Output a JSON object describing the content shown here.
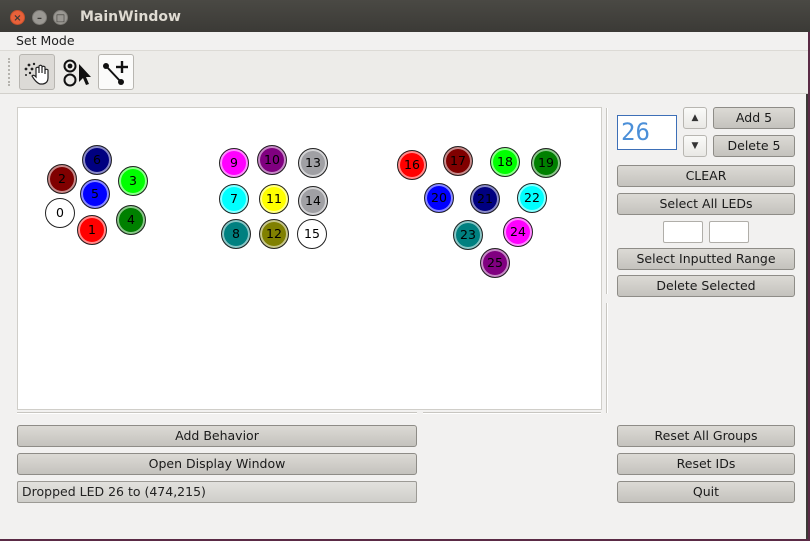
{
  "window": {
    "title": "MainWindow",
    "close_glyph": "×",
    "min_glyph": "–",
    "max_glyph": "□"
  },
  "menubar": {
    "set_mode": "Set Mode"
  },
  "toolbar": {
    "tools": [
      "hand-drag-icon",
      "select-pointer-icon",
      "connect-node-icon"
    ],
    "active_tool": "hand-drag-icon"
  },
  "leds": [
    {
      "id": "0",
      "color": "#ffffff"
    },
    {
      "id": "1",
      "color": "#ff0000"
    },
    {
      "id": "2",
      "color": "#800000"
    },
    {
      "id": "3",
      "color": "#00ff00"
    },
    {
      "id": "4",
      "color": "#008000"
    },
    {
      "id": "5",
      "color": "#0000ff"
    },
    {
      "id": "6",
      "color": "#000080"
    },
    {
      "id": "7",
      "color": "#00ffff"
    },
    {
      "id": "8",
      "color": "#008080"
    },
    {
      "id": "9",
      "color": "#ff00ff"
    },
    {
      "id": "10",
      "color": "#800080"
    },
    {
      "id": "11",
      "color": "#ffff00"
    },
    {
      "id": "12",
      "color": "#808000"
    },
    {
      "id": "13",
      "color": "#a0a0a4"
    },
    {
      "id": "14",
      "color": "#a0a0a4"
    },
    {
      "id": "15",
      "color": "#ffffff"
    },
    {
      "id": "16",
      "color": "#ff0000"
    },
    {
      "id": "17",
      "color": "#800000"
    },
    {
      "id": "18",
      "color": "#00ff00"
    },
    {
      "id": "19",
      "color": "#008000"
    },
    {
      "id": "20",
      "color": "#0000ff"
    },
    {
      "id": "21",
      "color": "#000080"
    },
    {
      "id": "22",
      "color": "#00ffff"
    },
    {
      "id": "23",
      "color": "#008080"
    },
    {
      "id": "24",
      "color": "#ff00ff"
    },
    {
      "id": "25",
      "color": "#800080"
    }
  ],
  "controls": {
    "count_value": "26",
    "spin_up": "▲",
    "spin_down": "▼",
    "add5": "Add 5",
    "delete5": "Delete 5",
    "clear": "CLEAR",
    "select_all": "Select All LEDs",
    "range_start": "",
    "range_end": "",
    "select_range": "Select Inputted Range",
    "delete_selected": "Delete Selected"
  },
  "bottom": {
    "add_behavior": "Add Behavior",
    "open_display": "Open Display Window",
    "status": "Dropped LED 26 to (474,215)",
    "reset_groups": "Reset All Groups",
    "reset_ids": "Reset IDs",
    "quit": "Quit"
  }
}
